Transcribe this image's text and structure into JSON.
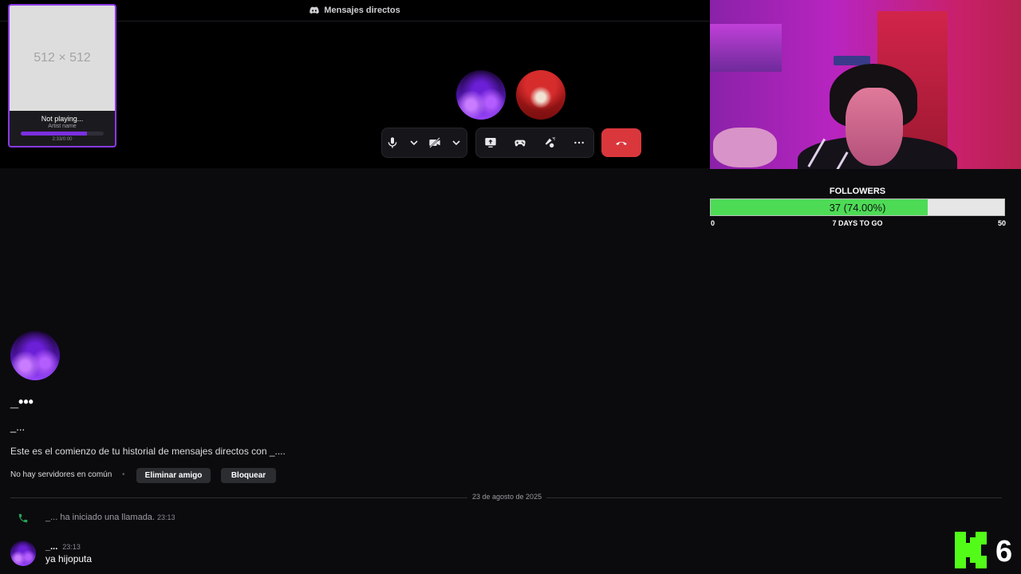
{
  "header": {
    "title": "Mensajes directos"
  },
  "music": {
    "cover_placeholder": "512 × 512",
    "track": "Not playing...",
    "artist": "Artist name",
    "time": "2:33/0:00",
    "progress_fraction": 0.8
  },
  "controls": {
    "icons": [
      "microphone-icon",
      "caret-down-icon",
      "camera-off-icon",
      "caret-down-icon",
      "screen-share-icon",
      "activity-gamepad-icon",
      "soundboard-icon",
      "more-icon",
      "hangup-icon"
    ],
    "hangup_color": "#da373c"
  },
  "followers": {
    "title": "FOLLOWERS",
    "count_text": "37 (74.00%)",
    "progress_fraction": 0.74,
    "min": "0",
    "days_to_go": "7 DAYS TO GO",
    "max": "50",
    "fill_color": "#4ddb56"
  },
  "dm": {
    "display_name": "_•••",
    "username": "_...",
    "intro": "Este es el comienzo de tu historial de mensajes directos con _....",
    "no_servers": "No hay servidores en común",
    "separator": "•",
    "remove_friend": "Eliminar amigo",
    "block": "Bloquear"
  },
  "divider": {
    "date": "23 de agosto de 2025"
  },
  "messages": {
    "call_text": "_... ha iniciado una llamada.",
    "call_time": "23:13",
    "author": "_...",
    "time": "23:13",
    "text": "ya hijoputa"
  },
  "overlay": {
    "kick_count": "6",
    "kick_color": "#53fc18"
  }
}
